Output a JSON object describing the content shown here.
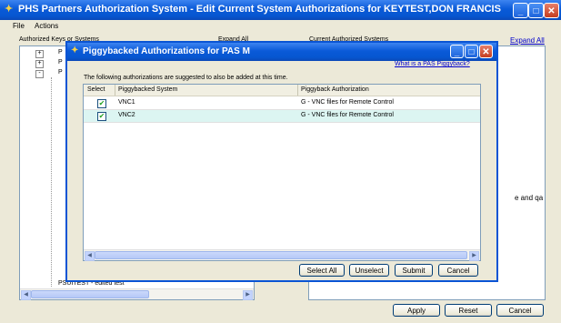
{
  "window": {
    "title": "PHS Partners Authorization System - Edit Current System Authorizations for KEYTEST,DON FRANCIS"
  },
  "menu": {
    "file": "File",
    "actions": "Actions"
  },
  "left_panel": {
    "header": "Authorized Keys or Systems",
    "expand_all": "Expand All",
    "tree_items": [
      "P",
      "P",
      "P"
    ],
    "bottom_item": "PSUITEST - edited test"
  },
  "right_panel": {
    "header": "Current Authorized Systems",
    "expand_all": "Expand All",
    "partial_text": "e and qa"
  },
  "main_buttons": {
    "apply": "Apply",
    "reset": "Reset",
    "cancel": "Cancel"
  },
  "dialog": {
    "title": "Piggybacked Authorizations for PAS M",
    "help_link": "What is a PAS Piggyback?",
    "instruction": "The following authorizations are suggested to also be added at this time.",
    "columns": {
      "select": "Select",
      "system": "Piggybacked System",
      "authorization": "Piggyback Authorization"
    },
    "rows": [
      {
        "checked": true,
        "system": "VNC1",
        "authorization": "G - VNC files for Remote Control"
      },
      {
        "checked": true,
        "system": "VNC2",
        "authorization": "G - VNC files for Remote Control"
      }
    ],
    "buttons": {
      "select_all": "Select All",
      "unselect": "Unselect",
      "submit": "Submit",
      "cancel": "Cancel"
    }
  }
}
